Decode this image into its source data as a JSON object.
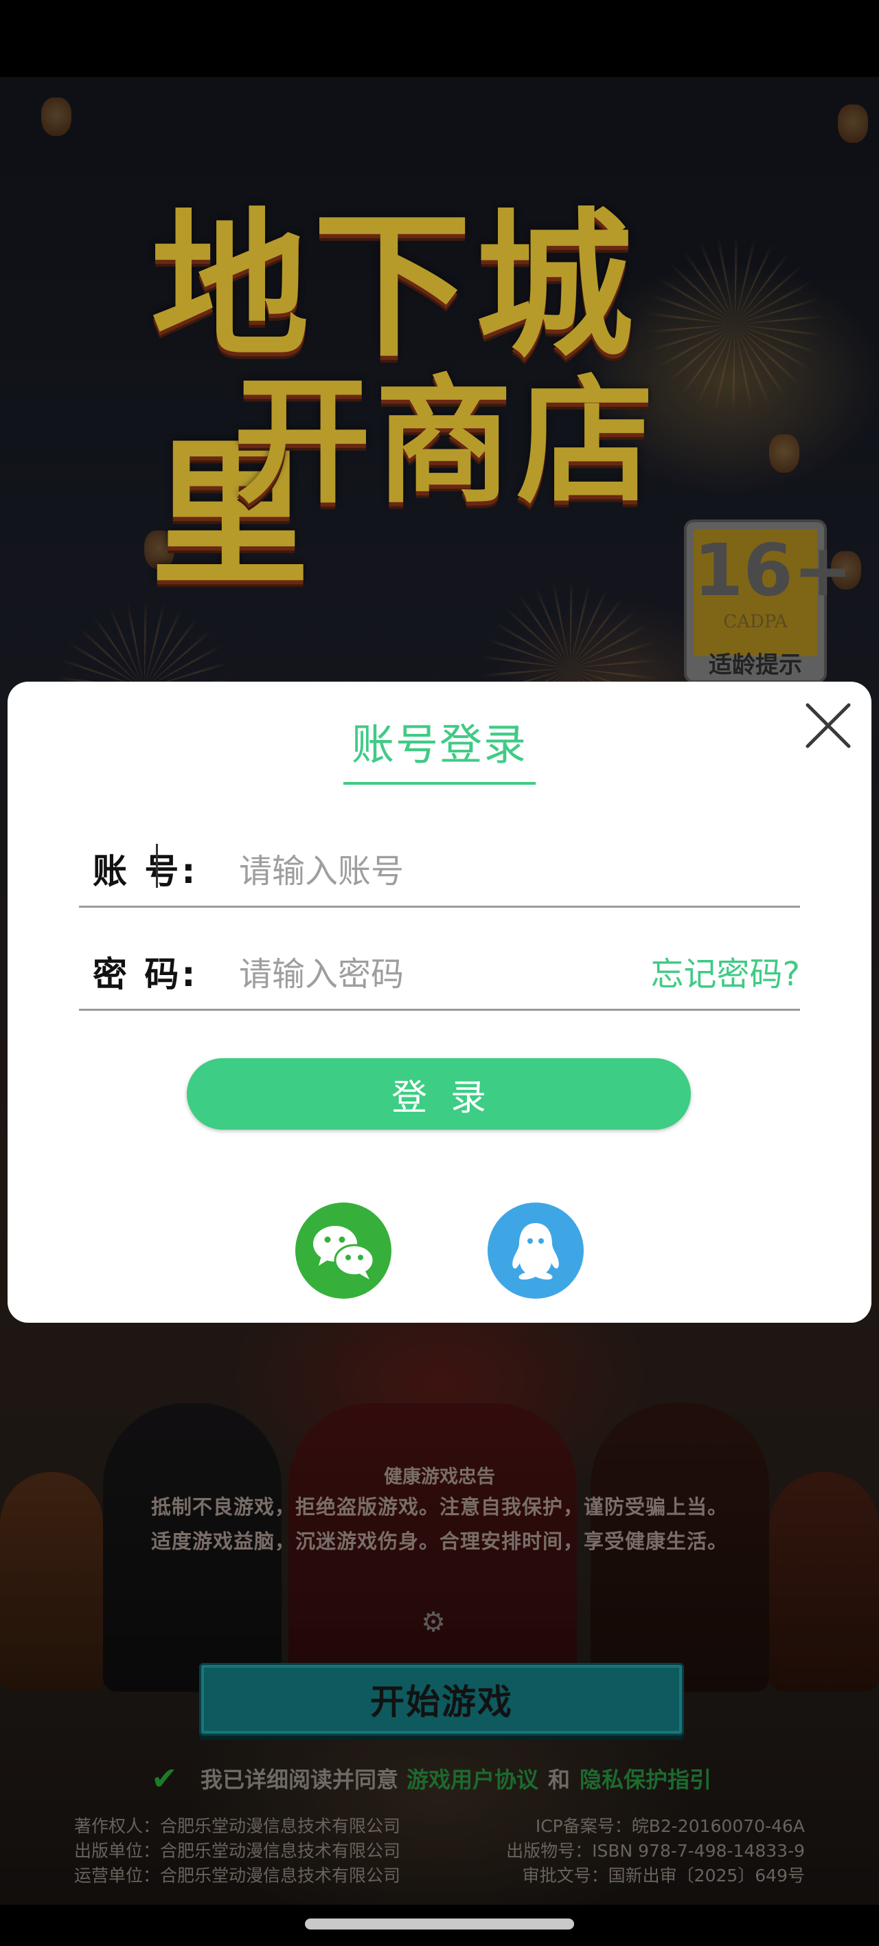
{
  "background": {
    "game_title_line1": "地下城里",
    "game_title_line2": "开商店",
    "age_rating": {
      "number": "16+",
      "org": "CADPA",
      "tip": "适龄提示"
    },
    "health_notice": {
      "title": "健康游戏忠告",
      "line1": "抵制不良游戏，拒绝盗版游戏。注意自我保护，谨防受骗上当。",
      "line2": "适度游戏益脑，沉迷游戏伤身。合理安排时间，享受健康生活。"
    },
    "start_button": "开始游戏",
    "agreement": {
      "prefix": "我已详细阅读并同意",
      "user_agreement": "游戏用户协议",
      "and": "和",
      "privacy": "隐私保护指引"
    },
    "credits": {
      "copyright": "著作权人：合肥乐堂动漫信息技术有限公司",
      "publisher": "出版单位：合肥乐堂动漫信息技术有限公司",
      "operator": "运营单位：合肥乐堂动漫信息技术有限公司",
      "icp": "ICP备案号：皖B2-20160070-46A",
      "isbn": "出版物号：ISBN 978-7-498-14833-9",
      "approval": "审批文号：国新出审〔2025〕649号"
    }
  },
  "login_dialog": {
    "title": "账号登录",
    "account_label": "账  号:",
    "account_placeholder": "请输入账号",
    "account_value": "",
    "password_label": "密  码:",
    "password_placeholder": "请输入密码",
    "password_value": "",
    "forgot_password": "忘记密码?",
    "login_button": "登录",
    "social_logins": [
      "wechat-icon",
      "qq-icon"
    ]
  },
  "colors": {
    "accent_green": "#3fcb85",
    "wechat_green": "#36b03a",
    "qq_blue": "#3fa6e6"
  }
}
